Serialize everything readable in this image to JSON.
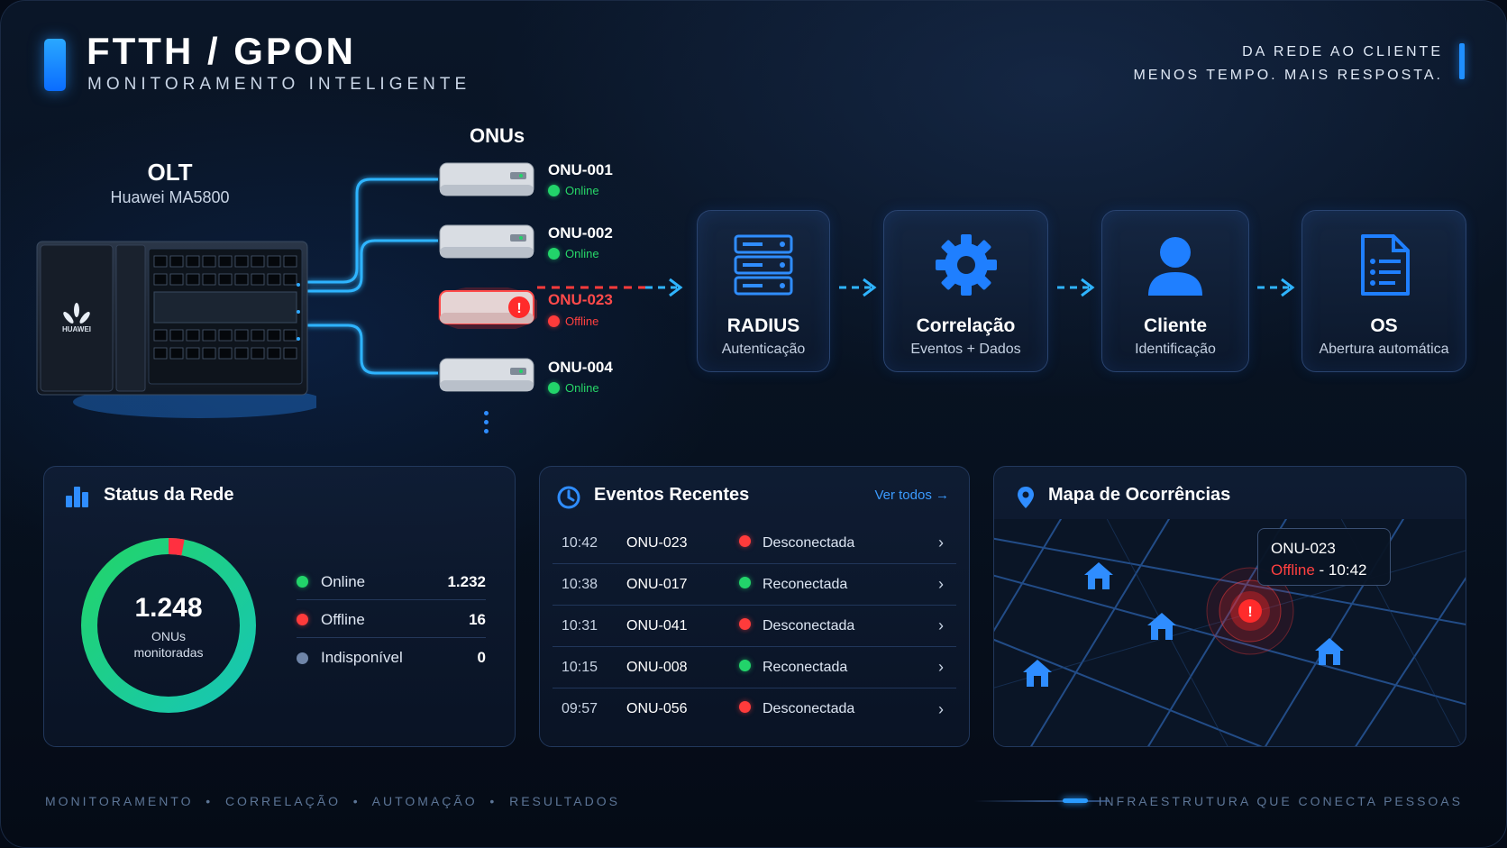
{
  "header": {
    "title": "FTTH / GPON",
    "subtitle": "MONITORAMENTO INTELIGENTE",
    "tagline_line1": "DA REDE AO CLIENTE",
    "tagline_line2": "MENOS TEMPO. MAIS RESPOSTA."
  },
  "olt": {
    "label": "OLT",
    "model": "Huawei MA5800",
    "brand": "HUAWEI"
  },
  "onus": {
    "title": "ONUs",
    "items": [
      {
        "name": "ONU-001",
        "status": "Online",
        "state": "online"
      },
      {
        "name": "ONU-002",
        "status": "Online",
        "state": "online"
      },
      {
        "name": "ONU-023",
        "status": "Offline",
        "state": "offline"
      },
      {
        "name": "ONU-004",
        "status": "Online",
        "state": "online"
      }
    ]
  },
  "flow": [
    {
      "title": "RADIUS",
      "subtitle": "Autenticação",
      "icon": "server-icon"
    },
    {
      "title": "Correlação",
      "subtitle": "Eventos + Dados",
      "icon": "gear-icon"
    },
    {
      "title": "Cliente",
      "subtitle": "Identificação",
      "icon": "user-icon"
    },
    {
      "title": "OS",
      "subtitle": "Abertura automática",
      "icon": "document-icon"
    }
  ],
  "status_panel": {
    "title": "Status da Rede",
    "total": "1.248",
    "caption_line1": "ONUs",
    "caption_line2": "monitoradas",
    "legend": [
      {
        "label": "Online",
        "value": "1.232",
        "color": "#22d46a"
      },
      {
        "label": "Offline",
        "value": "16",
        "color": "#ff3b3b"
      },
      {
        "label": "Indisponível",
        "value": "0",
        "color": "#6f85a8"
      }
    ]
  },
  "events_panel": {
    "title": "Eventos Recentes",
    "see_all": "Ver todos →",
    "rows": [
      {
        "time": "10:42",
        "onu": "ONU-023",
        "desc": "Desconectada",
        "state": "off"
      },
      {
        "time": "10:38",
        "onu": "ONU-017",
        "desc": "Reconectada",
        "state": "on"
      },
      {
        "time": "10:31",
        "onu": "ONU-041",
        "desc": "Desconectada",
        "state": "off"
      },
      {
        "time": "10:15",
        "onu": "ONU-008",
        "desc": "Reconectada",
        "state": "on"
      },
      {
        "time": "09:57",
        "onu": "ONU-056",
        "desc": "Desconectada",
        "state": "off"
      }
    ]
  },
  "map_panel": {
    "title": "Mapa de Ocorrências",
    "tooltip_onu": "ONU-023",
    "tooltip_status": "Offline",
    "tooltip_time": " - 10:42"
  },
  "footer": {
    "left": "MONITORAMENTO  •  CORRELAÇÃO  •  AUTOMAÇÃO  •  RESULTADOS",
    "right": "INFRAESTRUTURA QUE CONECTA PESSOAS"
  },
  "colors": {
    "accent": "#2a9bff",
    "online": "#22d46a",
    "offline": "#ff3b3b"
  }
}
